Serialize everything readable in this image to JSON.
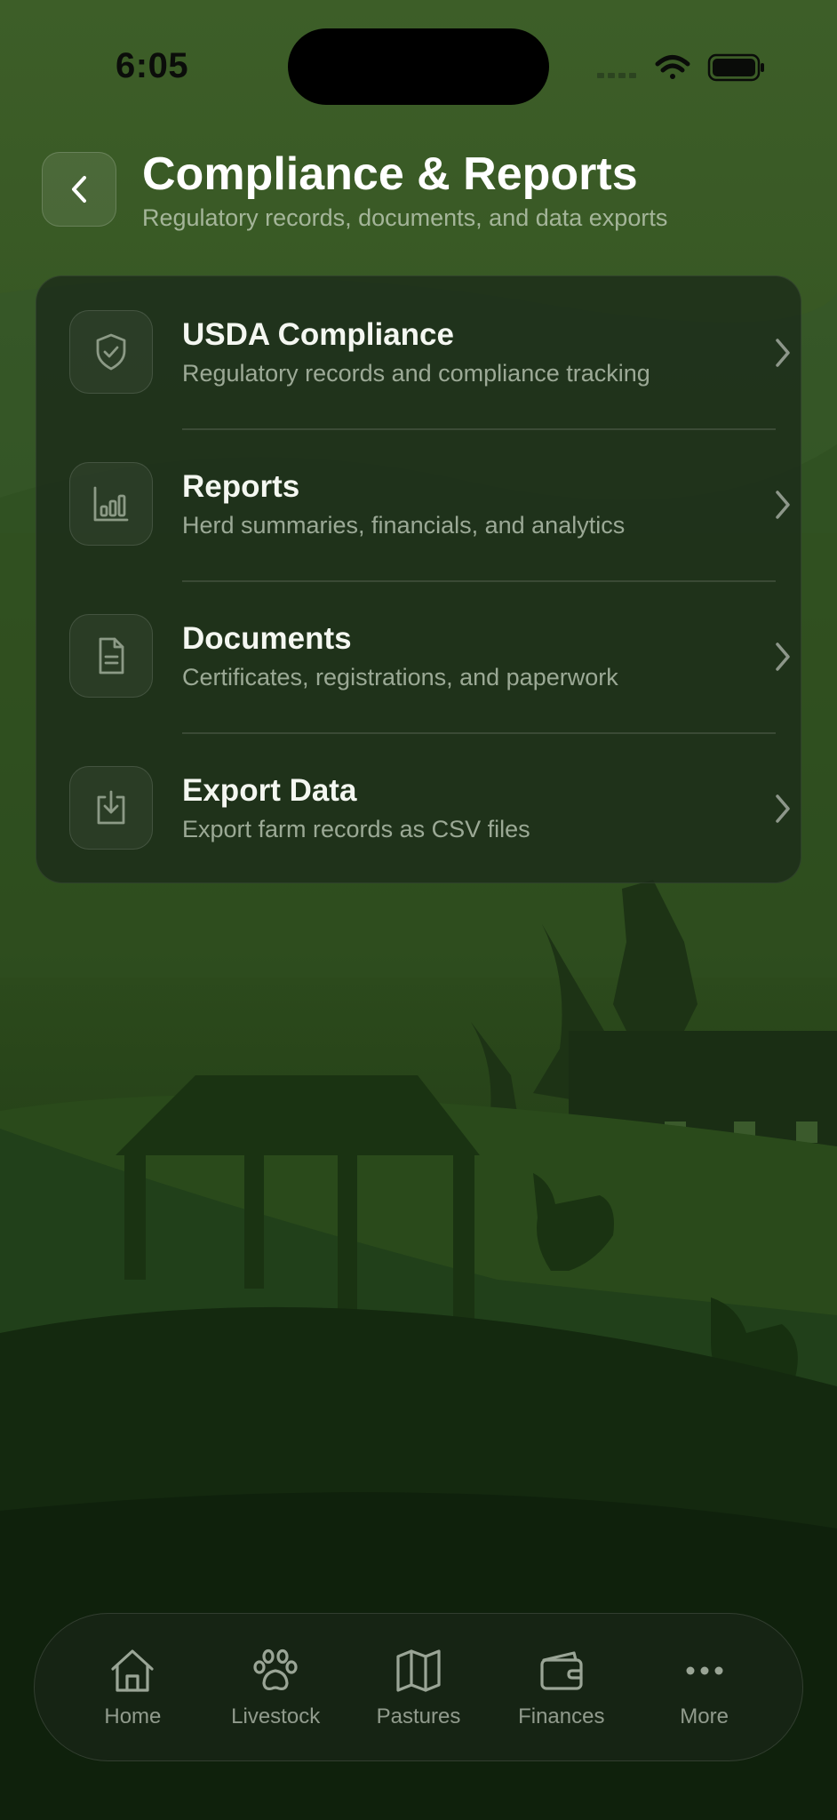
{
  "status_bar": {
    "time": "6:05"
  },
  "header": {
    "title": "Compliance & Reports",
    "subtitle": "Regulatory records, documents, and data exports"
  },
  "menu": {
    "items": [
      {
        "icon": "shield-check-icon",
        "title": "USDA Compliance",
        "description": "Regulatory records and compliance tracking"
      },
      {
        "icon": "bar-chart-icon",
        "title": "Reports",
        "description": "Herd summaries, financials, and analytics"
      },
      {
        "icon": "document-icon",
        "title": "Documents",
        "description": "Certificates, registrations, and paperwork"
      },
      {
        "icon": "download-icon",
        "title": "Export Data",
        "description": "Export farm records as CSV files"
      }
    ]
  },
  "tab_bar": {
    "items": [
      {
        "icon": "home-icon",
        "label": "Home"
      },
      {
        "icon": "paw-icon",
        "label": "Livestock"
      },
      {
        "icon": "map-icon",
        "label": "Pastures"
      },
      {
        "icon": "wallet-icon",
        "label": "Finances"
      },
      {
        "icon": "more-icon",
        "label": "More"
      }
    ]
  },
  "colors": {
    "background": "#1a3313",
    "card": "#1c2c1a",
    "text_primary": "#ffffff",
    "text_secondary": "#a9b4a3"
  }
}
